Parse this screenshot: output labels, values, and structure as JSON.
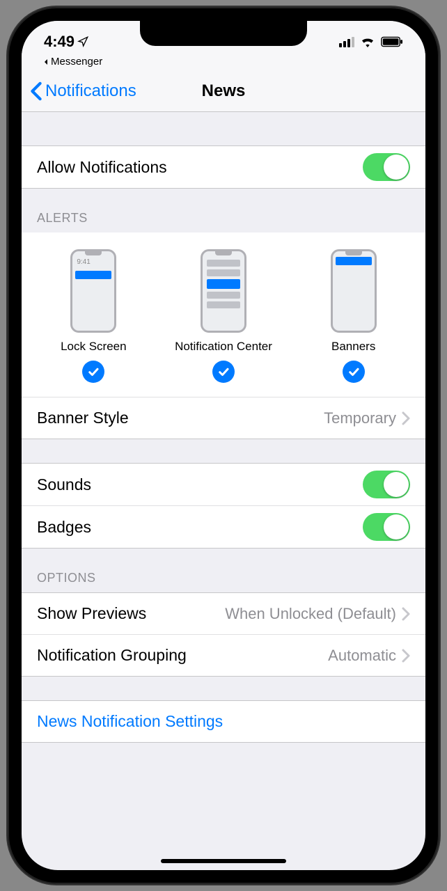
{
  "status": {
    "time": "4:49",
    "breadcrumb_app": "Messenger"
  },
  "nav": {
    "back_label": "Notifications",
    "title": "News"
  },
  "allow": {
    "label": "Allow Notifications",
    "on": true
  },
  "alerts": {
    "header": "Alerts",
    "lock_screen": {
      "label": "Lock Screen",
      "time": "9:41",
      "checked": true
    },
    "notification_center": {
      "label": "Notification Center",
      "checked": true
    },
    "banners": {
      "label": "Banners",
      "checked": true
    },
    "banner_style": {
      "label": "Banner Style",
      "value": "Temporary"
    }
  },
  "sounds": {
    "label": "Sounds",
    "on": true
  },
  "badges": {
    "label": "Badges",
    "on": true
  },
  "options": {
    "header": "Options",
    "previews": {
      "label": "Show Previews",
      "value": "When Unlocked (Default)"
    },
    "grouping": {
      "label": "Notification Grouping",
      "value": "Automatic"
    }
  },
  "footer": {
    "link": "News Notification Settings"
  }
}
